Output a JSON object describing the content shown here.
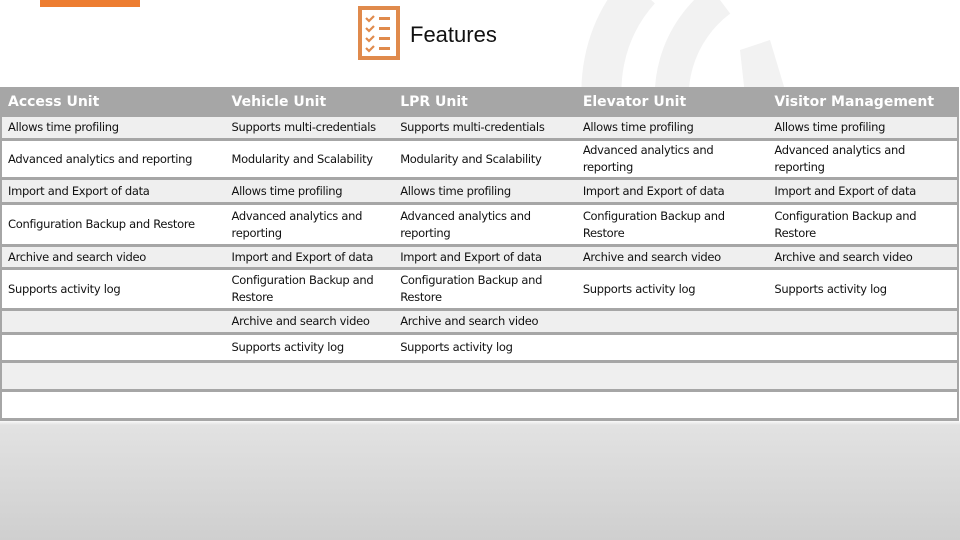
{
  "slide": {
    "title": "Features",
    "icon": "checklist-icon",
    "accent_color": "#ED7D31",
    "header_bg": "#A6A6A6"
  },
  "table": {
    "headers": [
      "Access Unit",
      "Vehicle Unit",
      "LPR Unit",
      "Elevator Unit",
      "Visitor Management"
    ],
    "rows": [
      [
        "Allows time profiling",
        "Supports multi-credentials",
        "Supports multi-credentials",
        "Allows time profiling",
        "Allows time profiling"
      ],
      [
        "Advanced analytics and reporting",
        "Modularity and Scalability",
        "Modularity and Scalability",
        "Advanced analytics and reporting",
        "Advanced analytics and reporting"
      ],
      [
        "Import and Export of data",
        "Allows time profiling",
        "Allows time profiling",
        "Import and Export of data",
        "Import and Export of data"
      ],
      [
        "Configuration Backup and Restore",
        "Advanced analytics and reporting",
        "Advanced analytics and reporting",
        "Configuration Backup and Restore",
        "Configuration Backup and Restore"
      ],
      [
        "Archive and search video",
        "Import and Export of data",
        "Import and Export of data",
        "Archive and search video",
        "Archive and search video"
      ],
      [
        "Supports activity log",
        "Configuration Backup and Restore",
        "Configuration Backup and Restore",
        "Supports activity log",
        "Supports activity log"
      ],
      [
        "",
        "Archive and search video",
        "Archive and search video",
        "",
        ""
      ],
      [
        "",
        "Supports activity log",
        "Supports activity log",
        "",
        ""
      ]
    ],
    "empty_rows": 2
  }
}
